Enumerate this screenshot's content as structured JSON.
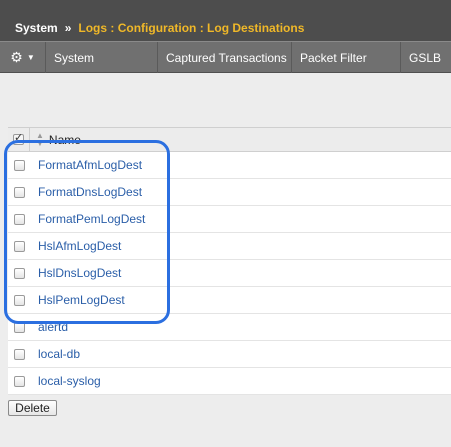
{
  "breadcrumb": {
    "root": "System",
    "separator": "»",
    "path": "Logs : Configuration : Log Destinations"
  },
  "menubar": {
    "gear_icon": "gear-icon",
    "tabs": [
      "System",
      "Captured Transactions",
      "Packet Filter",
      "GSLB"
    ]
  },
  "table": {
    "header_name": "Name",
    "rows": [
      "FormatAfmLogDest",
      "FormatDnsLogDest",
      "FormatPemLogDest",
      "HslAfmLogDest",
      "HslDnsLogDest",
      "HslPemLogDest",
      "alertd",
      "local-db",
      "local-syslog"
    ]
  },
  "actions": {
    "delete_label": "Delete"
  },
  "colors": {
    "breadcrumb_accent": "#f0b828",
    "link": "#2a5ea8",
    "highlight": "#2b6fe0"
  }
}
